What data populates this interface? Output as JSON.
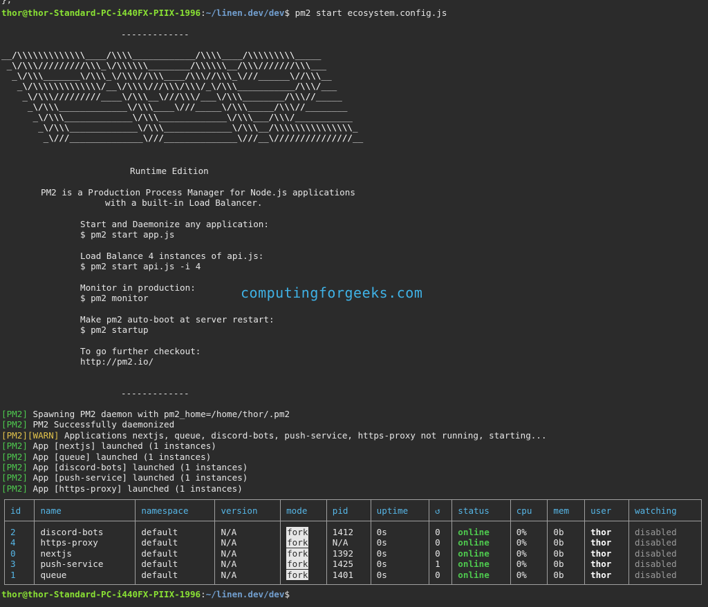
{
  "terminal": {
    "prev_line": "};",
    "prompt": {
      "user_host": "thor@thor-Standard-PC-i440FX-PIIX-1996",
      "colon": ":",
      "path": "~/linen.dev/dev",
      "dollar": "$"
    },
    "command": " pm2 start ecosystem.config.js",
    "final_prompt_suffix": ""
  },
  "banner": {
    "sep_top": "-------------",
    "ascii": [
      "__/\\\\\\\\\\\\\\\\\\\\\\\\\\____/\\\\\\\\____________/\\\\\\\\____/\\\\\\\\\\\\\\\\\\_____",
      " _\\/\\\\\\/////////\\\\\\_\\/\\\\\\\\\\\\________/\\\\\\\\\\\\__/\\\\\\///////\\\\\\___",
      "  _\\/\\\\\\_______\\/\\\\\\_\\/\\\\\\//\\\\\\____/\\\\\\//\\\\\\_\\///______\\//\\\\\\__",
      "   _\\/\\\\\\\\\\\\\\\\\\\\\\\\\\/__\\/\\\\\\\\///\\\\\\/\\\\\\/_\\/\\\\\\___________/\\\\\\/___",
      "    _\\/\\\\\\/////////____\\/\\\\\\__\\///\\\\\\/___\\/\\\\\\________/\\\\\\//_____",
      "     _\\/\\\\\\_____________\\/\\\\\\____\\///_____\\/\\\\\\_____/\\\\\\//________",
      "      _\\/\\\\\\_____________\\/\\\\\\_____________\\/\\\\\\___/\\\\\\/___________",
      "       _\\/\\\\\\_____________\\/\\\\\\_____________\\/\\\\\\__/\\\\\\\\\\\\\\\\\\\\\\\\\\\\\\_",
      "        _\\///______________\\///______________\\///__\\///////////////__"
    ],
    "edition": "Runtime Edition",
    "desc1": "PM2 is a Production Process Manager for Node.js applications",
    "desc2": "with a built-in Load Balancer.",
    "tip1": "Start and Daemonize any application:",
    "cmd1": "$ pm2 start app.js",
    "tip2": "Load Balance 4 instances of api.js:",
    "cmd2": "$ pm2 start api.js -i 4",
    "tip3": "Monitor in production:",
    "cmd3": "$ pm2 monitor",
    "tip4": "Make pm2 auto-boot at server restart:",
    "cmd4": "$ pm2 startup",
    "tip5": "To go further checkout:",
    "link": "http://pm2.io/",
    "sep_bottom": "-------------"
  },
  "watermark": "computingforgeeks.com",
  "logs": [
    {
      "tag": "[PM2]",
      "text": " Spawning PM2 daemon with pm2_home=/home/thor/.pm2",
      "warn": false
    },
    {
      "tag": "[PM2]",
      "text": " PM2 Successfully daemonized",
      "warn": false
    },
    {
      "tag": "[PM2][WARN]",
      "text": " Applications nextjs, queue, discord-bots, push-service, https-proxy not running, starting...",
      "warn": true
    },
    {
      "tag": "[PM2]",
      "text": " App [nextjs] launched (1 instances)",
      "warn": false
    },
    {
      "tag": "[PM2]",
      "text": " App [queue] launched (1 instances)",
      "warn": false
    },
    {
      "tag": "[PM2]",
      "text": " App [discord-bots] launched (1 instances)",
      "warn": false
    },
    {
      "tag": "[PM2]",
      "text": " App [push-service] launched (1 instances)",
      "warn": false
    },
    {
      "tag": "[PM2]",
      "text": " App [https-proxy] launched (1 instances)",
      "warn": false
    }
  ],
  "table": {
    "headers": [
      "id",
      "name",
      "namespace",
      "version",
      "mode",
      "pid",
      "uptime",
      "↺",
      "status",
      "cpu",
      "mem",
      "user",
      "watching"
    ],
    "rows": [
      [
        "2",
        "discord-bots",
        "default",
        "N/A",
        "fork",
        "1412",
        "0s",
        "0",
        "online",
        "0%",
        "0b",
        "thor",
        "disabled"
      ],
      [
        "4",
        "https-proxy",
        "default",
        "N/A",
        "fork",
        "N/A",
        "0s",
        "0",
        "online",
        "0%",
        "0b",
        "thor",
        "disabled"
      ],
      [
        "0",
        "nextjs",
        "default",
        "N/A",
        "fork",
        "1392",
        "0s",
        "0",
        "online",
        "0%",
        "0b",
        "thor",
        "disabled"
      ],
      [
        "3",
        "push-service",
        "default",
        "N/A",
        "fork",
        "1425",
        "0s",
        "1",
        "online",
        "0%",
        "0b",
        "thor",
        "disabled"
      ],
      [
        "1",
        "queue",
        "default",
        "N/A",
        "fork",
        "1401",
        "0s",
        "0",
        "online",
        "0%",
        "0b",
        "thor",
        "disabled"
      ]
    ]
  },
  "colors": {
    "background": "#2b2b2b",
    "prompt_user": "#8ae234",
    "prompt_path": "#729fcf",
    "pm2_tag": "#4ec84e",
    "warn_tag": "#e0c14b",
    "header": "#56b6e6",
    "watermark": "#3fb2e6"
  }
}
